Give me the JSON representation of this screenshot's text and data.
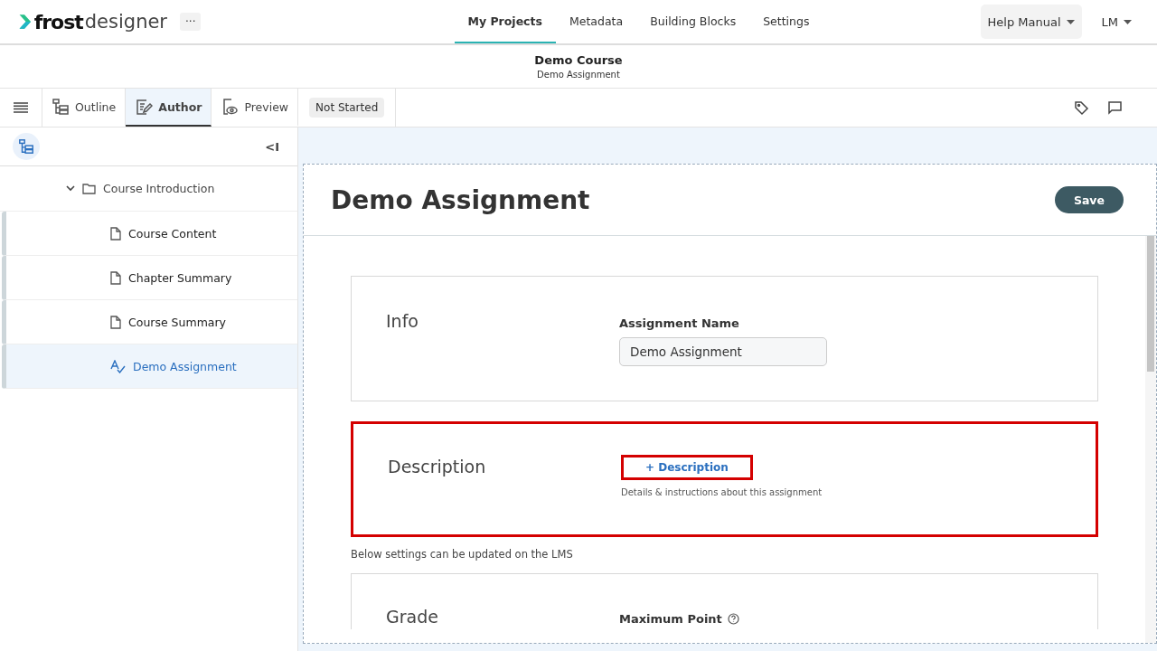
{
  "logo": {
    "strong": "frost",
    "light": "designer"
  },
  "more_button": "···",
  "nav": [
    {
      "label": "My Projects",
      "selected": true
    },
    {
      "label": "Metadata",
      "selected": false
    },
    {
      "label": "Building Blocks",
      "selected": false
    },
    {
      "label": "Settings",
      "selected": false
    }
  ],
  "help_menu": "Help Manual",
  "user_menu": "LM",
  "header": {
    "course": "Demo Course",
    "assignment": "Demo Assignment"
  },
  "mode_tabs": [
    {
      "label": "Outline",
      "kind": "outline",
      "selected": false
    },
    {
      "label": "Author",
      "kind": "author",
      "selected": true
    },
    {
      "label": "Preview",
      "kind": "preview",
      "selected": false
    }
  ],
  "status": "Not Started",
  "collapse_button": "<I",
  "tree": [
    {
      "label": "Course Introduction",
      "kind": "folder",
      "expanded": true,
      "selected": false,
      "children": [
        {
          "label": "Course Content",
          "kind": "page",
          "selected": false
        },
        {
          "label": "Chapter Summary",
          "kind": "page",
          "selected": false
        },
        {
          "label": "Course Summary",
          "kind": "page",
          "selected": false
        },
        {
          "label": "Demo Assignment",
          "kind": "assignment",
          "selected": true
        }
      ]
    }
  ],
  "editor": {
    "title": "Demo Assignment",
    "save": "Save",
    "sections": [
      {
        "kind": "field",
        "title": "Info",
        "label": "Assignment Name",
        "value": "Demo Assignment",
        "highlighted": false
      },
      {
        "kind": "add",
        "title": "Description",
        "button": "+ Description",
        "hint": "Details & instructions about this assignment",
        "highlighted": true,
        "button_highlighted": true
      }
    ],
    "note": "Below settings can be updated on the LMS",
    "grade": {
      "title": "Grade",
      "label": "Maximum Point"
    }
  }
}
